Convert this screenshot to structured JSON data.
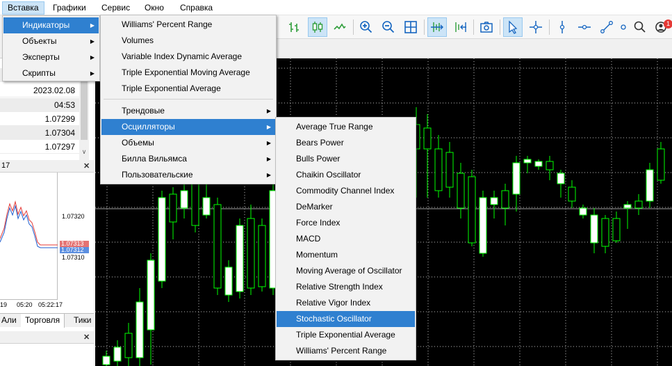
{
  "menubar": {
    "items": [
      "Вставка",
      "Графики",
      "Сервис",
      "Окно",
      "Справка"
    ]
  },
  "insert_menu": {
    "items": [
      "Индикаторы",
      "Объекты",
      "Эксперты",
      "Скрипты"
    ]
  },
  "indicators_menu": {
    "recent": [
      "Williams' Percent Range",
      "Volumes",
      "Variable Index Dynamic Average",
      "Triple Exponential Moving Average",
      "Triple Exponential Average"
    ],
    "groups": [
      "Трендовые",
      "Осцилляторы",
      "Объемы",
      "Билла Вильямса",
      "Пользовательские"
    ]
  },
  "oscillators_menu": {
    "items": [
      "Average True Range",
      "Bears Power",
      "Bulls Power",
      "Chaikin Oscillator",
      "Commodity Channel Index",
      "DeMarker",
      "Force Index",
      "MACD",
      "Momentum",
      "Moving Average of Oscillator",
      "Relative Strength Index",
      "Relative Vigor Index",
      "Stochastic Oscillator",
      "Triple Exponential Average",
      "Williams' Percent Range"
    ],
    "selected": "Stochastic Oscillator"
  },
  "market_watch": {
    "rows": [
      "2023.02.08",
      "04:53",
      "1.07299",
      "1.07304",
      "1.07297"
    ]
  },
  "mini_chart": {
    "header": "17",
    "price_labels": [
      "1.07320",
      "1.07313",
      "1.07312",
      "1.07310"
    ],
    "time_labels": [
      "19",
      "05:20",
      "05:22:17"
    ]
  },
  "bottom_tabs": [
    "Али",
    "Торговля",
    "Тики"
  ],
  "notification_count": "1",
  "colors": {
    "accent": "#2f80d0",
    "bull_candle": "#ffffff",
    "wick": "#00ff00",
    "chart_bg": "#000000",
    "ask_label": "#e57373",
    "bid_label": "#5c8fe0"
  }
}
